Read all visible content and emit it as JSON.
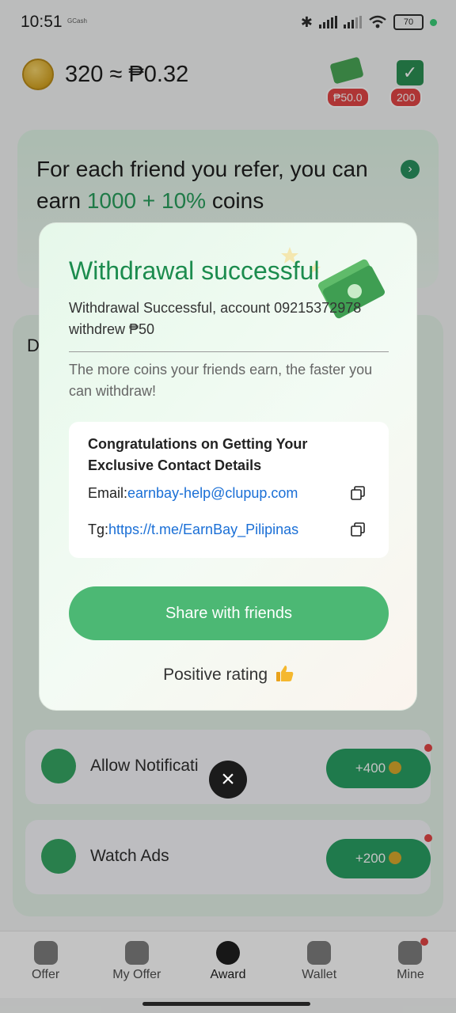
{
  "status_bar": {
    "time": "10:51",
    "app_label": "GCash",
    "battery": "70"
  },
  "header": {
    "balance": "320 ≈ ₱0.32",
    "withdraw_badge": "₱50.0",
    "checkin_badge": "200"
  },
  "referral": {
    "text_before": "For each friend you refer, you can earn ",
    "highlight": "1000 + 10%",
    "text_after": " coins"
  },
  "section": {
    "label_initial": "D"
  },
  "tasks": [
    {
      "label": "Allow Notificati",
      "reward": "+400"
    },
    {
      "label": "Watch Ads",
      "reward": "+200"
    }
  ],
  "tabs": [
    {
      "label": "Offer"
    },
    {
      "label": "My Offer"
    },
    {
      "label": "Award"
    },
    {
      "label": "Wallet"
    },
    {
      "label": "Mine"
    }
  ],
  "modal": {
    "title": "Withdrawal successful",
    "message": "Withdrawal Successful, account 09215372978 withdrew ₱50",
    "note": "The more coins your friends earn, the faster you can withdraw!",
    "contact_title": "Congratulations on Getting Your Exclusive Contact Details",
    "email_label": "Email:",
    "email_value": "earnbay-help@clupup.com",
    "tg_label": "Tg:",
    "tg_value": "https://t.me/EarnBay_Pilipinas",
    "share_button": "Share with friends",
    "rating_text": "Positive rating"
  },
  "colors": {
    "accent_green": "#1c8c4e",
    "button_green": "#4cb874",
    "link_blue": "#1a6fd6",
    "badge_red": "#e23b3b"
  },
  "icons": [
    "bluetooth-icon",
    "signal-icon",
    "wifi-icon",
    "battery-icon",
    "coin-icon",
    "cash-icon",
    "calendar-check-icon",
    "chevron-right-icon",
    "copy-icon",
    "thumbs-up-icon",
    "close-icon",
    "megaphone-icon",
    "video-icon",
    "home-icon",
    "clipboard-icon",
    "medal-icon",
    "wallet-icon",
    "user-icon"
  ]
}
